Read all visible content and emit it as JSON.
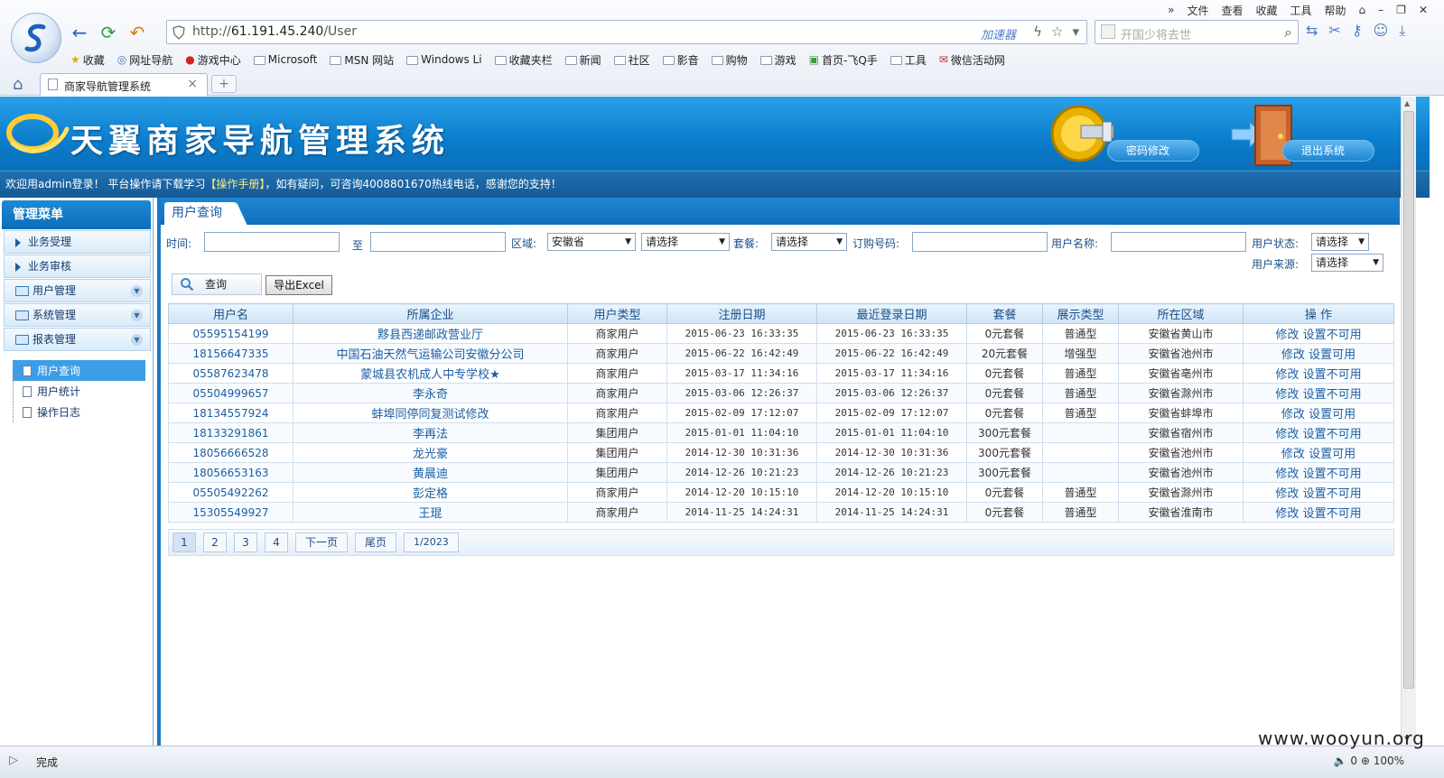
{
  "browser": {
    "menu": [
      "文件",
      "查看",
      "收藏",
      "工具",
      "帮助"
    ],
    "address_prefix": "http://",
    "address_host": "61.191.45.240",
    "address_path": "/User",
    "accelerator": "加速器",
    "search_placeholder": "开国少将去世",
    "favorites": [
      {
        "icon": "star-icon",
        "label": "收藏"
      },
      {
        "icon": "globe-icon",
        "label": "网址导航"
      },
      {
        "icon": "game-icon",
        "label": "游戏中心"
      },
      {
        "icon": "folder-icon",
        "label": "Microsoft"
      },
      {
        "icon": "folder-icon",
        "label": "MSN 网站"
      },
      {
        "icon": "folder-icon",
        "label": "Windows Li"
      },
      {
        "icon": "folder-icon",
        "label": "收藏夹栏"
      },
      {
        "icon": "folder-icon",
        "label": "新闻"
      },
      {
        "icon": "folder-icon",
        "label": "社区"
      },
      {
        "icon": "folder-icon",
        "label": "影音"
      },
      {
        "icon": "folder-icon",
        "label": "购物"
      },
      {
        "icon": "folder-icon",
        "label": "游戏"
      },
      {
        "icon": "page-icon",
        "label": "首页-飞Q手"
      },
      {
        "icon": "folder-icon",
        "label": "工具"
      },
      {
        "icon": "gift-icon",
        "label": "微信活动网"
      }
    ],
    "tab_title": "商家导航管理系统",
    "status_text": "完成",
    "zoom": "100%",
    "zoom_count": "0"
  },
  "header": {
    "title": "天翼商家导航管理系统",
    "change_password": "密码修改",
    "logout": "退出系统",
    "welcome_prefix": "欢迎用admin登录！  平台操作请下载学习",
    "welcome_manual": "【操作手册】",
    "welcome_suffix": "，如有疑问，可咨询4008801670热线电话，感谢您的支持！"
  },
  "sidebar": {
    "heading": "管理菜单",
    "items": [
      {
        "label": "业务受理",
        "kind": "arrow"
      },
      {
        "label": "业务审核",
        "kind": "arrow"
      },
      {
        "label": "用户管理",
        "kind": "folder"
      },
      {
        "label": "系统管理",
        "kind": "folder"
      },
      {
        "label": "报表管理",
        "kind": "folder"
      }
    ],
    "tree": [
      {
        "label": "用户查询",
        "active": true
      },
      {
        "label": "用户统计",
        "active": false
      },
      {
        "label": "操作日志",
        "active": false
      }
    ]
  },
  "main": {
    "tab": "用户查询",
    "filters": {
      "time_label": "时间:",
      "to_label": "至",
      "region_label": "区域:",
      "region_value": "安徽省",
      "city_value": "请选择",
      "package_label": "套餐:",
      "package_value": "请选择",
      "order_label": "订购号码:",
      "username_label": "用户名称:",
      "status_label": "用户状态:",
      "status_value": "请选择",
      "source_label": "用户来源:",
      "source_value": "请选择"
    },
    "query_button": "查询",
    "export_button": "导出Excel",
    "columns": [
      "用户名",
      "所属企业",
      "用户类型",
      "注册日期",
      "最近登录日期",
      "套餐",
      "展示类型",
      "所在区域",
      "操 作"
    ],
    "rows": [
      [
        "05595154199",
        "黟县西递邮政营业厅",
        "商家用户",
        "2015-06-23 16:33:35",
        "2015-06-23 16:33:35",
        "0元套餐",
        "普通型",
        "安徽省黄山市",
        "修改",
        "设置不可用"
      ],
      [
        "18156647335",
        "中国石油天然气运输公司安徽分公司",
        "商家用户",
        "2015-06-22 16:42:49",
        "2015-06-22 16:42:49",
        "20元套餐",
        "增强型",
        "安徽省池州市",
        "修改",
        "设置可用"
      ],
      [
        "05587623478",
        "蒙城县农机成人中专学校★",
        "商家用户",
        "2015-03-17 11:34:16",
        "2015-03-17 11:34:16",
        "0元套餐",
        "普通型",
        "安徽省亳州市",
        "修改",
        "设置不可用"
      ],
      [
        "05504999657",
        "李永奇",
        "商家用户",
        "2015-03-06 12:26:37",
        "2015-03-06 12:26:37",
        "0元套餐",
        "普通型",
        "安徽省滁州市",
        "修改",
        "设置不可用"
      ],
      [
        "18134557924",
        "蚌埠同停同复测试修改",
        "商家用户",
        "2015-02-09 17:12:07",
        "2015-02-09 17:12:07",
        "0元套餐",
        "普通型",
        "安徽省蚌埠市",
        "修改",
        "设置可用"
      ],
      [
        "18133291861",
        "李再法",
        "集团用户",
        "2015-01-01 11:04:10",
        "2015-01-01 11:04:10",
        "300元套餐",
        "",
        "安徽省宿州市",
        "修改",
        "设置不可用"
      ],
      [
        "18056666528",
        "龙光豪",
        "集团用户",
        "2014-12-30 10:31:36",
        "2014-12-30 10:31:36",
        "300元套餐",
        "",
        "安徽省池州市",
        "修改",
        "设置可用"
      ],
      [
        "18056653163",
        "黄晨迪",
        "集团用户",
        "2014-12-26 10:21:23",
        "2014-12-26 10:21:23",
        "300元套餐",
        "",
        "安徽省池州市",
        "修改",
        "设置不可用"
      ],
      [
        "05505492262",
        "彭定格",
        "商家用户",
        "2014-12-20 10:15:10",
        "2014-12-20 10:15:10",
        "0元套餐",
        "普通型",
        "安徽省滁州市",
        "修改",
        "设置不可用"
      ],
      [
        "15305549927",
        "王琨",
        "商家用户",
        "2014-11-25 14:24:31",
        "2014-11-25 14:24:31",
        "0元套餐",
        "普通型",
        "安徽省淮南市",
        "修改",
        "设置不可用"
      ]
    ],
    "pager": {
      "pages": [
        "1",
        "2",
        "3",
        "4"
      ],
      "next": "下一页",
      "last": "尾页",
      "info": "1/2023"
    }
  },
  "watermark": "www.wooyun.org",
  "colors": {
    "brand": "#0b7dcc",
    "link": "#1b5ea3",
    "header_dark": "#155b96"
  }
}
